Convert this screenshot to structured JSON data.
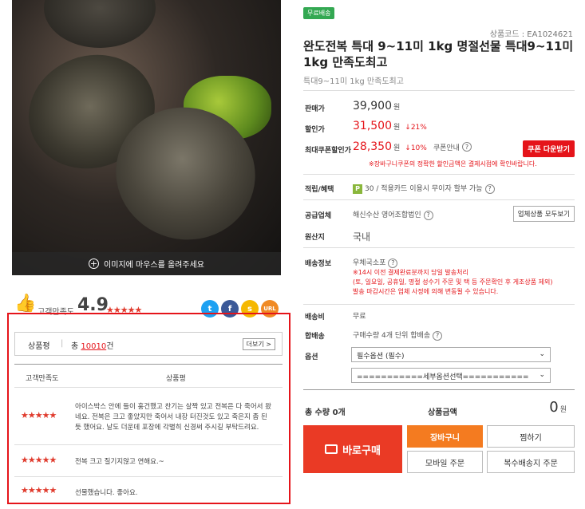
{
  "image": {
    "hover_hint": "이미지에 마우스를 올려주세요"
  },
  "satisfaction": {
    "label": "고객만족도",
    "score": "4.9",
    "stars": "★★★★★"
  },
  "share": {
    "twitter": "t",
    "facebook": "f",
    "kakaostory": "s",
    "url": "URL"
  },
  "reviews": {
    "title": "상품평",
    "count_prefix": "총",
    "count": "10010",
    "count_suffix": "건",
    "more_label": "더보기 >",
    "col_satisfaction": "고객만족도",
    "col_review": "상품평",
    "items": [
      {
        "stars": "★★★★★",
        "text": "아이스박스 안에 들이 훙건했고 찬기는 살짝 있고 전복은 다 죽어서 왔네요. 전복은 크고 좋았지만 죽어서 내장 터진것도 있고 죽은지 좀 된 듯 했어요. 날도 더운데 포장에 각별히 신경써 주시길 부탁드려요."
      },
      {
        "stars": "★★★★★",
        "text": "전복 크고 질기지않고 연해요.~"
      },
      {
        "stars": "★★★★★",
        "text": "선물했습니다. 좋아요."
      }
    ]
  },
  "product": {
    "badge": "무료배송",
    "code": "상품코드 : EA1024621",
    "title": "완도전복 특대 9~11미 1kg 명절선물 특대9~11미 1kg 만족도최고",
    "subtitle": "특대9~11미 1kg 만족도최고"
  },
  "price": {
    "sale_label": "판매가",
    "sale_price": "39,900",
    "won": "원",
    "discount_label": "할인가",
    "discount_price": "31,500",
    "discount_rate": "↓21%",
    "coupon_label": "최대쿠폰할인가",
    "coupon_price": "28,350",
    "coupon_rate": "↓10%",
    "coupon_info": "쿠폰안내",
    "coupon_button": "쿠폰 다운받기",
    "coupon_note": "※장바구니쿠폰의 정확한 할인금액은 결제시점에 확인바랍니다."
  },
  "points": {
    "label": "적립/혜택",
    "icon": "P",
    "value": "30",
    "extra": "/ 적용카드 이용시 무이자 할부 가능"
  },
  "supplier": {
    "label": "공급업체",
    "value": "해신수산 영어조합법인",
    "button": "업체상품 모두보기"
  },
  "origin": {
    "label": "원산지",
    "value": "국내"
  },
  "shipping": {
    "label": "배송정보",
    "value": "우체국소포",
    "notes": [
      "※14시 이전 결제완료분까지 당일 발송처리",
      "(토, 일요일, 공휴일, 명절 성수기 주문 및 택 등 주문확인 후 게조상품 제외)",
      "발송 마감시간은 업체 사정에 의해 변동될 수 있습니다."
    ]
  },
  "fee": {
    "label": "배송비",
    "value": "무료"
  },
  "bundle": {
    "label": "합배송",
    "value": "구매수량 4개 단위 합배송"
  },
  "options": {
    "label": "옵션",
    "required": "필수옵션 (필수)",
    "sub": "===========세부옵션선택==========="
  },
  "total": {
    "qty_label": "총 수량 0개",
    "amount_label": "상품금액",
    "amount": "0",
    "won": "원"
  },
  "buttons": {
    "buy": "바로구매",
    "cart": "장바구니",
    "wish": "찜하기",
    "mobile": "모바일 주문",
    "multi": "복수배송지 주문"
  }
}
